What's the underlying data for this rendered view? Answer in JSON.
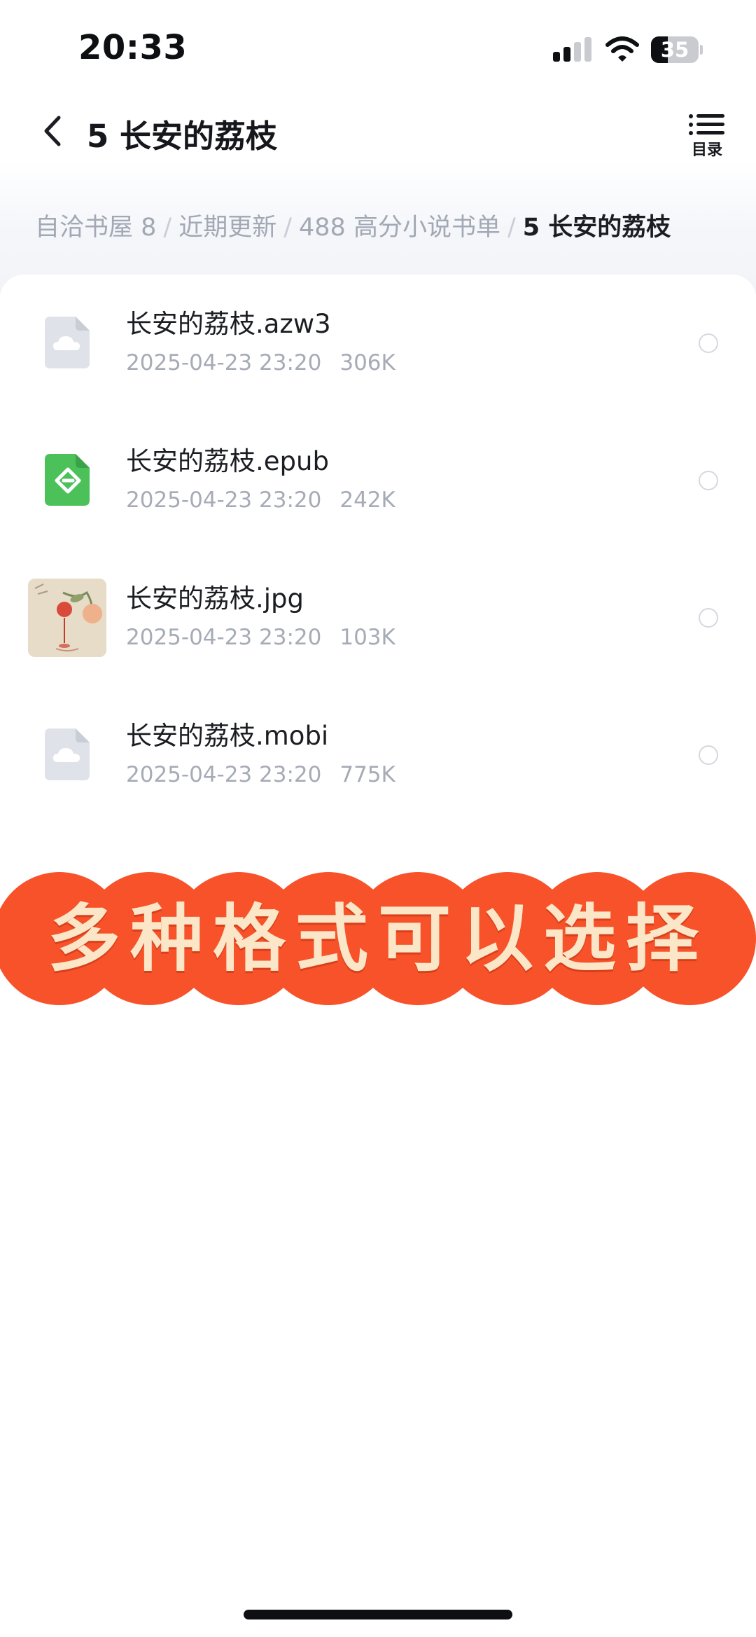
{
  "status_bar": {
    "time": "20:33",
    "battery": "35",
    "battery_level": 0.35
  },
  "header": {
    "title": "5 长安的荔枝",
    "toc_label": "目录",
    "back_icon": "chevron-left-icon",
    "toc_icon": "list-icon"
  },
  "breadcrumb": {
    "items": [
      "自洽书屋 8",
      "近期更新",
      "488 高分小说书单",
      "5 长安的荔枝"
    ],
    "separator": "/"
  },
  "files": [
    {
      "name": "长安的荔枝.azw3",
      "date": "2025-04-23 23:20",
      "size": "306K",
      "icon": "cloud-file-icon"
    },
    {
      "name": "长安的荔枝.epub",
      "date": "2025-04-23 23:20",
      "size": "242K",
      "icon": "epub-icon"
    },
    {
      "name": "长安的荔枝.jpg",
      "date": "2025-04-23 23:20",
      "size": "103K",
      "icon": "image-thumbnail"
    },
    {
      "name": "长安的荔枝.mobi",
      "date": "2025-04-23 23:20",
      "size": "775K",
      "icon": "cloud-file-icon"
    }
  ],
  "banner": {
    "text": "多种格式可以选择"
  },
  "colors": {
    "banner_bg": "#f7522a",
    "banner_text": "#fbe6c8",
    "epub_green": "#4cc15a",
    "muted_text": "#a6abb6"
  }
}
